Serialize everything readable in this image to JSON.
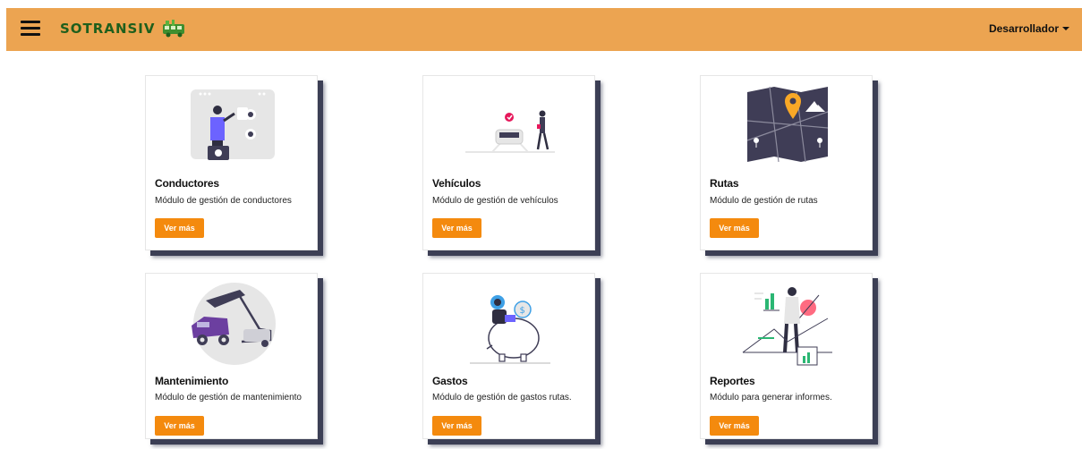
{
  "brand": {
    "name": "SOTRANSIV",
    "logo_icon": "bus-icon"
  },
  "user_menu": {
    "label": "Desarrollador"
  },
  "colors": {
    "navbar": "#eca451",
    "button": "#f48a0e",
    "shadow": "#3c3f55",
    "brand_text": "#1f5f1c"
  },
  "cards": [
    {
      "title": "Conductores",
      "description": "Módulo de gestión de conductores",
      "button": "Ver más",
      "illustration": "drivers-illustration"
    },
    {
      "title": "Vehículos",
      "description": "Módulo de gestión de vehículos",
      "button": "Ver más",
      "illustration": "vehicles-illustration"
    },
    {
      "title": "Rutas",
      "description": "Módulo de gestión de rutas",
      "button": "Ver más",
      "illustration": "routes-map-illustration"
    },
    {
      "title": "Mantenimiento",
      "description": "Módulo de gestión de mantenimiento",
      "button": "Ver más",
      "illustration": "maintenance-illustration"
    },
    {
      "title": "Gastos",
      "description": "Módulo de gestión de gastos rutas.",
      "button": "Ver más",
      "illustration": "expenses-piggybank-illustration"
    },
    {
      "title": "Reportes",
      "description": "Módulo para generar informes.",
      "button": "Ver más",
      "illustration": "reports-illustration"
    }
  ]
}
